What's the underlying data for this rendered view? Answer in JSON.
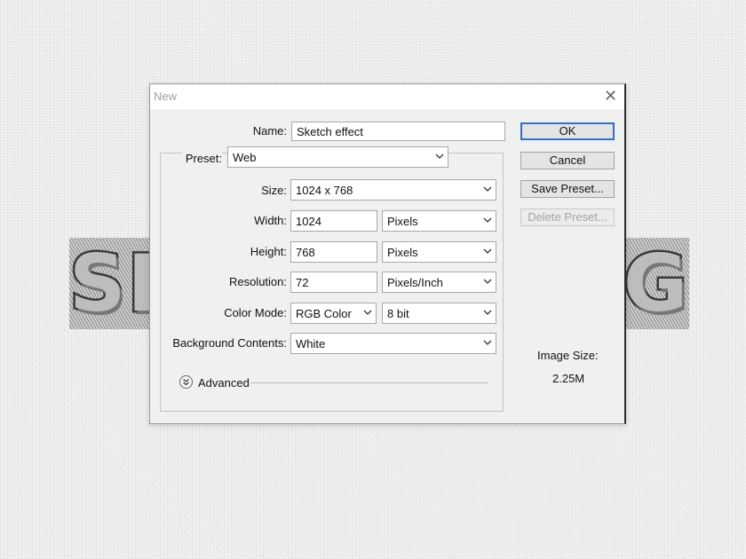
{
  "background": {
    "left_text": "SI",
    "right_text": "G"
  },
  "dialog": {
    "title": "New"
  },
  "form": {
    "name_label": "Name:",
    "name_value": "Sketch effect",
    "preset_label": "Preset:",
    "preset_value": "Web",
    "size_label": "Size:",
    "size_value": "1024 x 768",
    "width_label": "Width:",
    "width_value": "1024",
    "width_unit": "Pixels",
    "height_label": "Height:",
    "height_value": "768",
    "height_unit": "Pixels",
    "resolution_label": "Resolution:",
    "resolution_value": "72",
    "resolution_unit": "Pixels/Inch",
    "color_mode_label": "Color Mode:",
    "color_mode_value": "RGB Color",
    "bit_depth_value": "8 bit",
    "background_label": "Background Contents:",
    "background_value": "White",
    "advanced_label": "Advanced"
  },
  "buttons": {
    "ok": "OK",
    "cancel": "Cancel",
    "save_preset": "Save Preset...",
    "delete_preset": "Delete Preset..."
  },
  "image_size": {
    "label": "Image Size:",
    "value": "2.25M"
  },
  "colors": {
    "accent": "#2f72c4",
    "dialog_bg": "#f0f0f0",
    "disabled_text": "#a3a3a3"
  },
  "icons": [
    "close-icon",
    "chevron-down-icon",
    "advanced-expand-icon"
  ]
}
